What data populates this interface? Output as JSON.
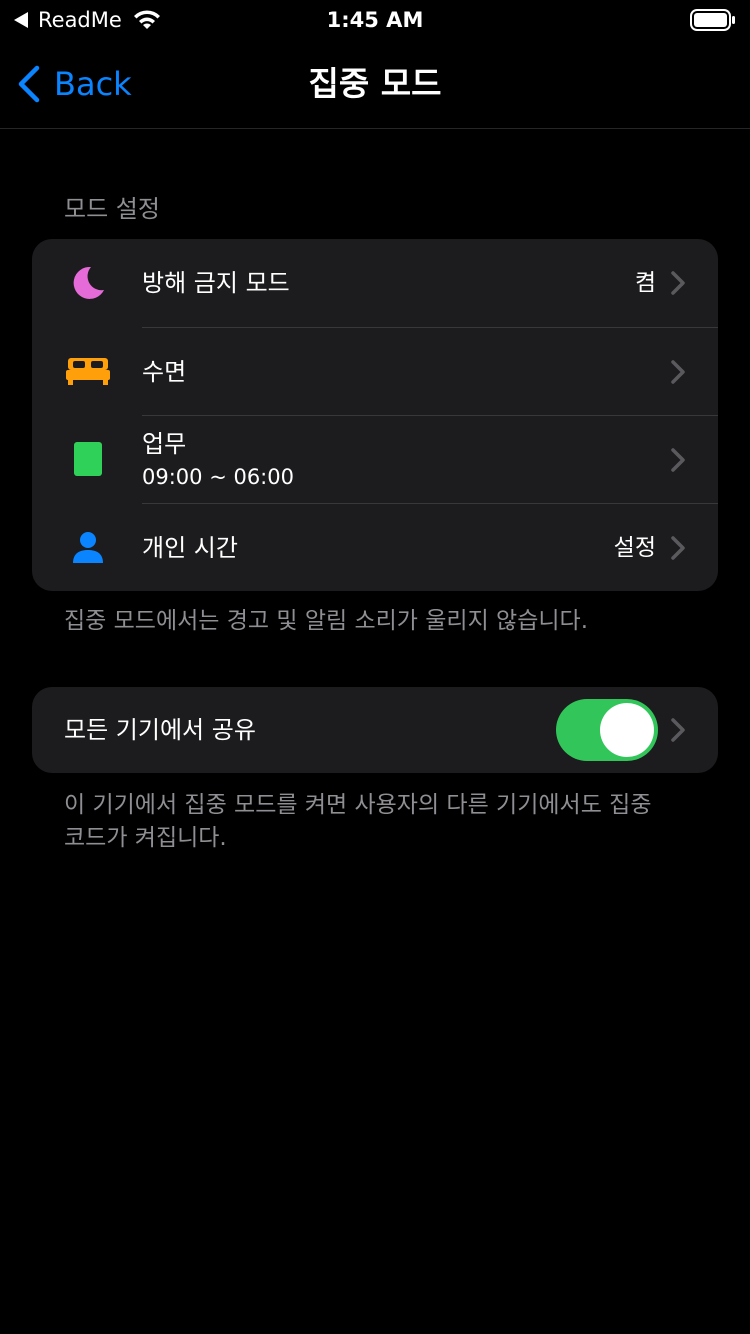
{
  "status_bar": {
    "app_name": "ReadMe",
    "time": "1:45 AM"
  },
  "nav": {
    "back_label": "Back",
    "title": "집중 모드"
  },
  "modes_section": {
    "header": "모드 설정",
    "items": [
      {
        "icon": "moon-icon",
        "color": "#e56bd8",
        "label": "방해 금지 모드",
        "value": "켬",
        "subtitle": ""
      },
      {
        "icon": "bed-icon",
        "color": "#ff9f0a",
        "label": "수면",
        "value": "",
        "subtitle": ""
      },
      {
        "icon": "work-badge-icon",
        "color": "#30d158",
        "label": "업무",
        "value": "",
        "subtitle": "09:00 ~ 06:00"
      },
      {
        "icon": "person-icon",
        "color": "#0a84ff",
        "label": "개인 시간",
        "value": "설정",
        "subtitle": ""
      }
    ],
    "footer": "집중 모드에서는 경고 및 알림 소리가 울리지 않습니다."
  },
  "share_section": {
    "label": "모든 기기에서 공유",
    "toggle_on": true,
    "footer_line1": "이 기기에서 집중 모드를 켜면 사용자의 다른 기기에서도 집중",
    "footer_line2": "코드가 켜집니다."
  },
  "colors": {
    "accent": "#0a84ff",
    "toggle_on": "#32c65a",
    "background": "#000000",
    "card": "#1c1c1e"
  }
}
